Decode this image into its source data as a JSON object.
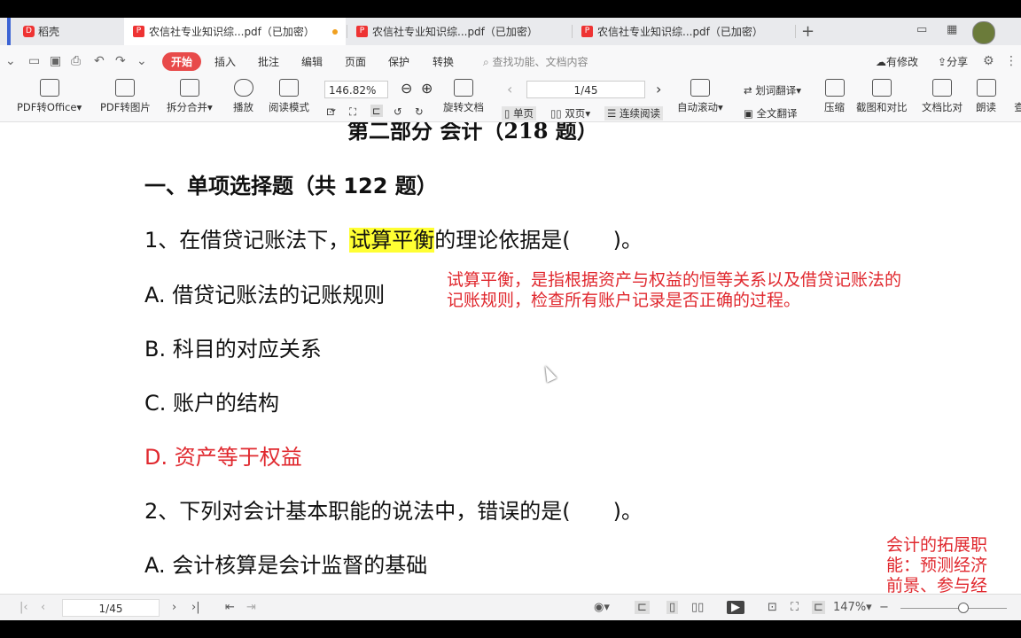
{
  "tabs": {
    "home": "稻壳",
    "active": "农信社专业知识综...pdf（已加密）",
    "t2": "农信社专业知识综...pdf（已加密）",
    "t3": "农信社专业知识综...pdf（已加密）"
  },
  "menu": {
    "items": [
      "开始",
      "插入",
      "批注",
      "编辑",
      "页面",
      "保护",
      "转换"
    ],
    "search_placeholder": "查找功能、文档内容",
    "has_changes": "有修改",
    "share": "分享"
  },
  "toolbar": {
    "pdf_to_office": "PDF转Office",
    "pdf_to_image": "PDF转图片",
    "split_merge": "拆分合并",
    "play": "播放",
    "read_mode": "阅读模式",
    "zoom": "146.82%",
    "rotate": "旋转文档",
    "page": "1/45",
    "single": "单页",
    "double": "双页",
    "continuous": "连续阅读",
    "auto_scroll": "自动滚动",
    "word_translate": "划词翻译",
    "full_translate": "全文翻译",
    "compress": "压缩",
    "capture_compare": "截图和对比",
    "doc_compare": "文档比对",
    "read_aloud": "朗读",
    "more": "查"
  },
  "document": {
    "partial_title": "第二部分 会计（218 题）",
    "section": "一、单项选择题（共 122 题）",
    "q1_prefix": "1、在借贷记账法下，",
    "q1_highlight": "试算平衡",
    "q1_suffix": "的理论依据是(　　)。",
    "q1_options": [
      "A.  借贷记账法的记账规则",
      "B.  科目的对应关系",
      "C.  账户的结构",
      "D.  资产等于权益"
    ],
    "note1_line1": "试算平衡，是指根据资产与权益的恒等关系以及借贷记账法的",
    "note1_line2": "记账规则，检查所有账户记录是否正确的过程。",
    "q2": "2、下列对会计基本职能的说法中，错误的是(　　)。",
    "q2_a": "A.  会计核算是会计监督的基础",
    "note2_line1": "会计的拓展职",
    "note2_line2": "能：预测经济",
    "note2_line3": "前景、参与经"
  },
  "statusbar": {
    "page": "1/45",
    "zoom": "147%"
  }
}
